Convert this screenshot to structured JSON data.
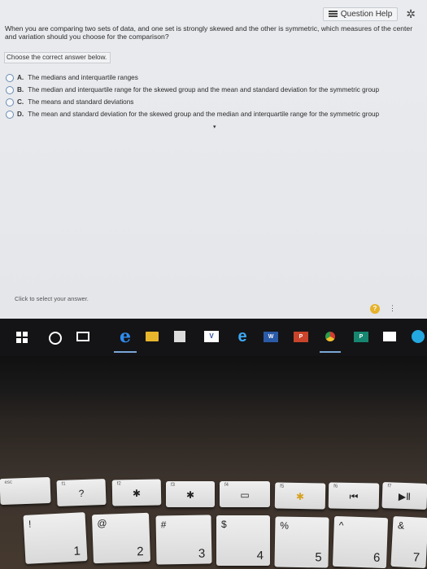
{
  "toolbar": {
    "help_label": "Question Help",
    "help_icon": "list-icon",
    "settings_icon": "gear-icon"
  },
  "question": {
    "text": "When you are comparing two sets of data, and one set is strongly skewed and the other is symmetric, which measures of the center and variation should you choose for the comparison?",
    "instruction": "Choose the correct answer below.",
    "options": [
      {
        "letter": "A.",
        "text": "The medians and interquartile ranges"
      },
      {
        "letter": "B.",
        "text": "The median and interquartile range for the skewed group and the mean and standard deviation for the symmetric group"
      },
      {
        "letter": "C.",
        "text": "The means and standard deviations"
      },
      {
        "letter": "D.",
        "text": "The mean and standard deviation for the skewed group and the median and interquartile range for the symmetric group"
      }
    ]
  },
  "footer": {
    "hint": "Click to select your answer.",
    "badge": "?",
    "more": "⋮"
  },
  "taskbar": {
    "edge_glyph": "e",
    "ie_glyph": "e",
    "vb_label": "V",
    "word_label": "W",
    "ppt_label": "P",
    "pub_label": "P"
  },
  "keyboard": {
    "fn_row": [
      {
        "fn": "esc",
        "glyph": ""
      },
      {
        "fn": "f1",
        "glyph": "?"
      },
      {
        "fn": "f2",
        "glyph": "✱"
      },
      {
        "fn": "f3",
        "glyph": "✱"
      },
      {
        "fn": "f4",
        "glyph": "▭"
      },
      {
        "fn": "f5",
        "glyph": "✱"
      },
      {
        "fn": "f6",
        "glyph": "⏮"
      },
      {
        "fn": "f7",
        "glyph": "▶Ⅱ"
      }
    ],
    "num_row": [
      {
        "top": "!",
        "bot": "1"
      },
      {
        "top": "@",
        "bot": "2"
      },
      {
        "top": "#",
        "bot": "3"
      },
      {
        "top": "$",
        "bot": "4"
      },
      {
        "top": "%",
        "bot": "5"
      },
      {
        "top": "^",
        "bot": "6"
      },
      {
        "top": "&",
        "bot": "7"
      }
    ]
  }
}
